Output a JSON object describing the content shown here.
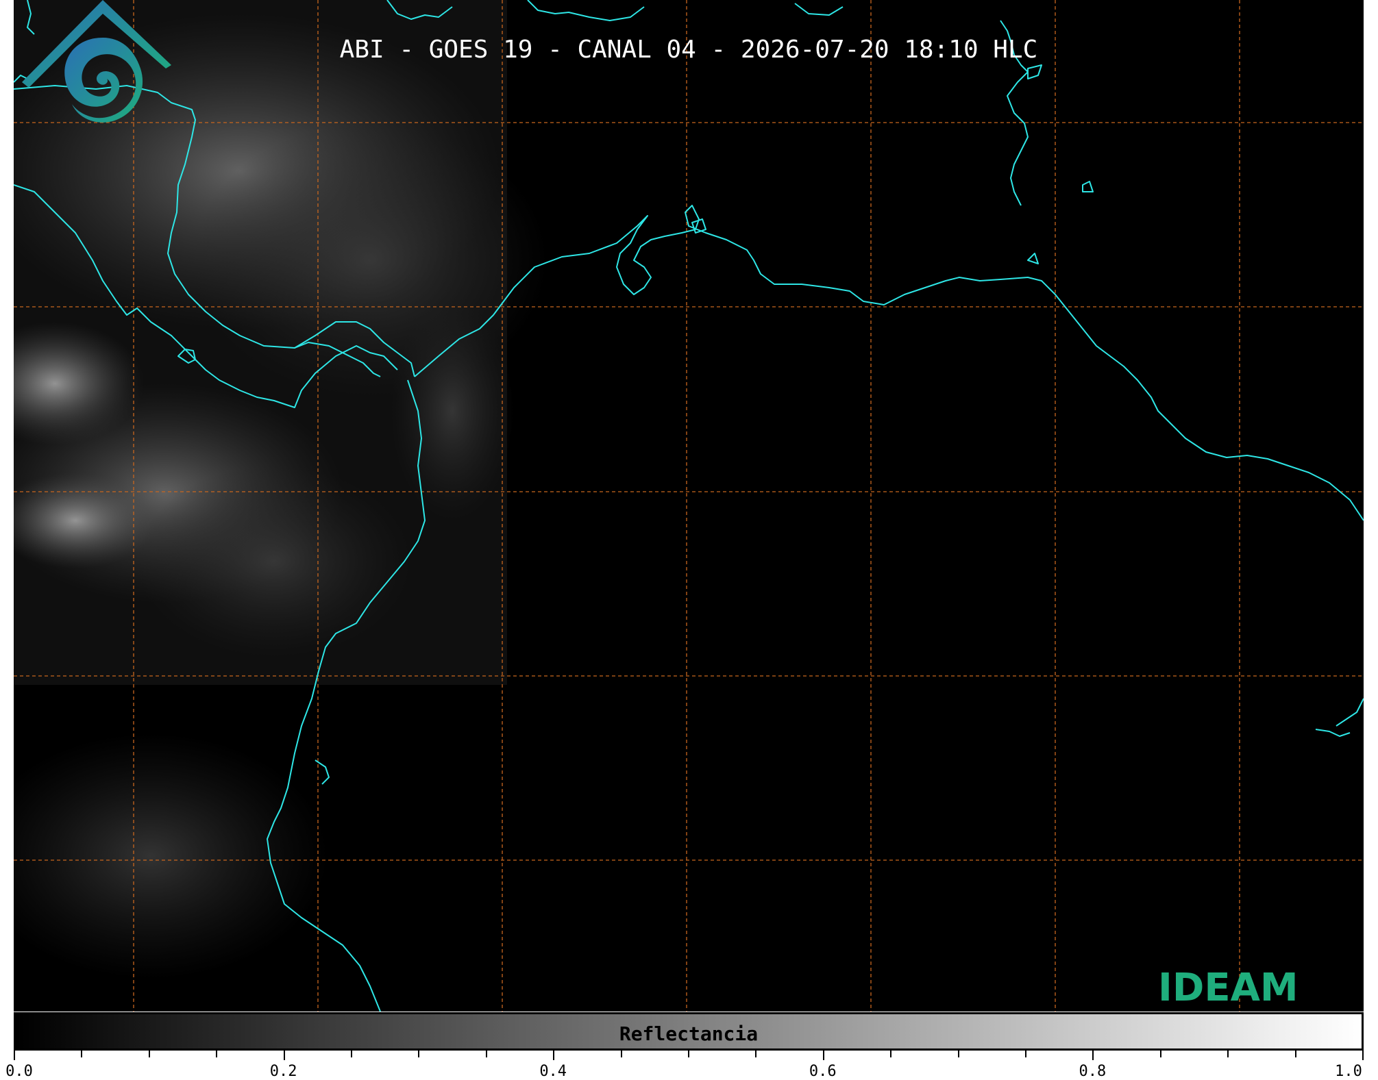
{
  "title": "ABI - GOES 19 - CANAL 04 - 2026-07-20 18:10 HLC",
  "logo_text": "IDEAM",
  "colorbar": {
    "label": "Reflectancia",
    "range": [
      0.0,
      1.0
    ],
    "tick_labels": [
      "0.0",
      "0.2",
      "0.4",
      "0.6",
      "0.8",
      "1.0"
    ],
    "tick_values": [
      0.0,
      0.2,
      0.4,
      0.6,
      0.8,
      1.0
    ]
  },
  "colors": {
    "coastline": "#2ee6e6",
    "grid": "#c8661e",
    "background": "#000000",
    "logo_primary": "#2a8fb0",
    "logo_secondary": "#1fae7d"
  },
  "icons": [
    "ideam-logo-icon"
  ]
}
